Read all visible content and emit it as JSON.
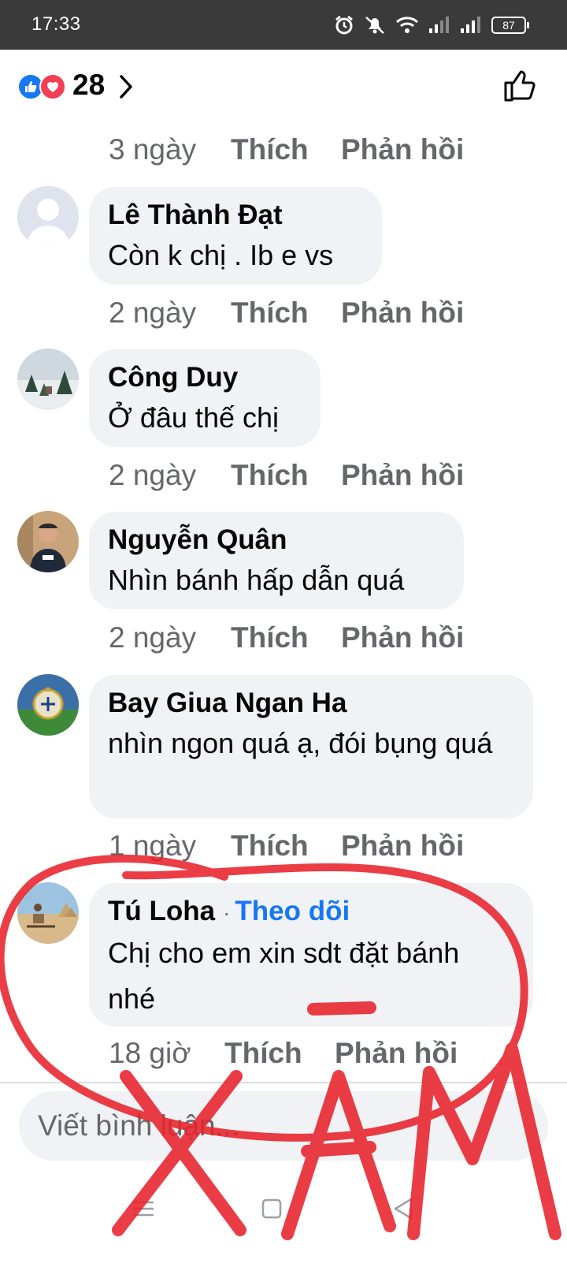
{
  "status_bar": {
    "time": "17:33",
    "battery": "87",
    "icons": [
      "alarm-icon",
      "mute-icon",
      "wifi-icon",
      "signal-icon",
      "signal-icon",
      "battery-icon"
    ]
  },
  "reactions": {
    "count": "28",
    "icons": [
      "like-reaction-icon",
      "love-reaction-icon",
      "chevron-right-icon",
      "thumbs-up-icon"
    ]
  },
  "top_meta": {
    "time": "3 ngày",
    "like": "Thích",
    "reply": "Phản hồi"
  },
  "comments": [
    {
      "author": "Lê Thành Đạt",
      "text": "Còn k chị . Ib e vs",
      "time": "2 ngày",
      "like": "Thích",
      "reply": "Phản hồi"
    },
    {
      "author": "Công Duy",
      "text": "Ở đâu thế chị",
      "time": "2 ngày",
      "like": "Thích",
      "reply": "Phản hồi"
    },
    {
      "author": "Nguyễn Quân",
      "text": "Nhìn bánh hấp dẫn quá",
      "time": "2 ngày",
      "like": "Thích",
      "reply": "Phản hồi"
    },
    {
      "author": "Bay Giua Ngan Ha",
      "text": "nhìn ngon quá ạ, đói bụng quá",
      "time": "1 ngày",
      "like": "Thích",
      "reply": "Phản hồi"
    },
    {
      "author": "Tú Loha",
      "follow_separator": "·",
      "follow": "Theo dõi",
      "text": "Chị cho em xin sdt đặt bánh nhé",
      "time": "18 giờ",
      "like": "Thích",
      "reply": "Phản hồi"
    }
  ],
  "composer": {
    "placeholder": "Viết bình luận..."
  },
  "annotation": {
    "text": "XÀM",
    "color": "#e8222b"
  },
  "colors": {
    "accent": "#1877f2",
    "like": "#1877f2",
    "love": "#f33e58",
    "bubble": "#f0f2f5",
    "meta": "#65676b"
  },
  "nav_bar": {
    "icons": [
      "menu-nav-icon",
      "home-nav-icon",
      "back-nav-icon"
    ]
  }
}
